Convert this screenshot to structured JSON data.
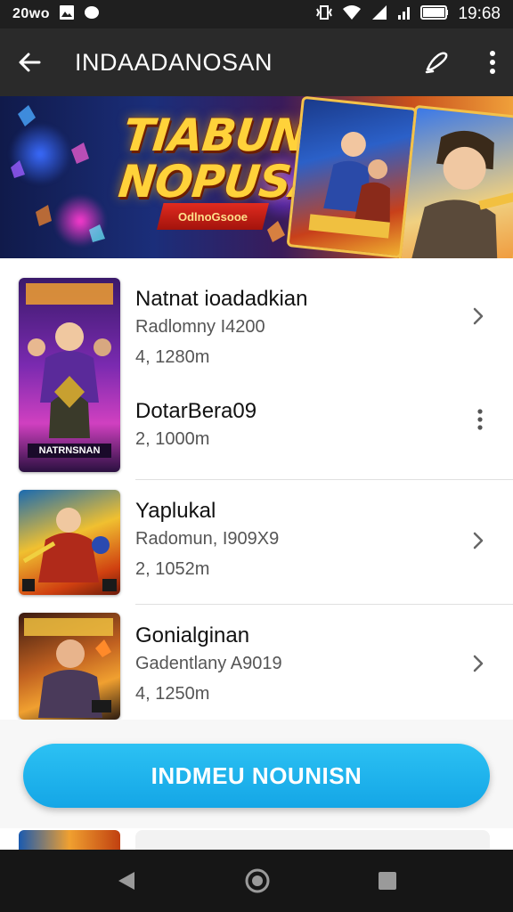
{
  "status_bar": {
    "left_time": "20ᴡᴏ",
    "right_time": "19:68"
  },
  "app_bar": {
    "title": "INDAADANOSAN"
  },
  "banner": {
    "title_line1": "TIABUN!",
    "title_line2": "NOPUSAN",
    "ribbon": "OdlnoGsooe"
  },
  "items": [
    {
      "thumb_text": "NATRNSNAN",
      "title": "Natnat ioadadkian",
      "sub": "Radlomny I4200",
      "meta": "4, 1280m",
      "sub_title": "DotarBera09",
      "sub_meta": "2, 1000m"
    },
    {
      "title": "Yaplukal",
      "sub": "Radomun, I909X9",
      "meta": "2, 1052m"
    },
    {
      "title": "Gonialginan",
      "sub": "Gadentlany A9019",
      "meta": "4, 1250m"
    }
  ],
  "cta": {
    "label": "INDMEU NOUNISN"
  },
  "colors": {
    "accent": "#14a6e6",
    "app_bar": "#2a2a2a",
    "status_bar": "#1f1f1f"
  }
}
